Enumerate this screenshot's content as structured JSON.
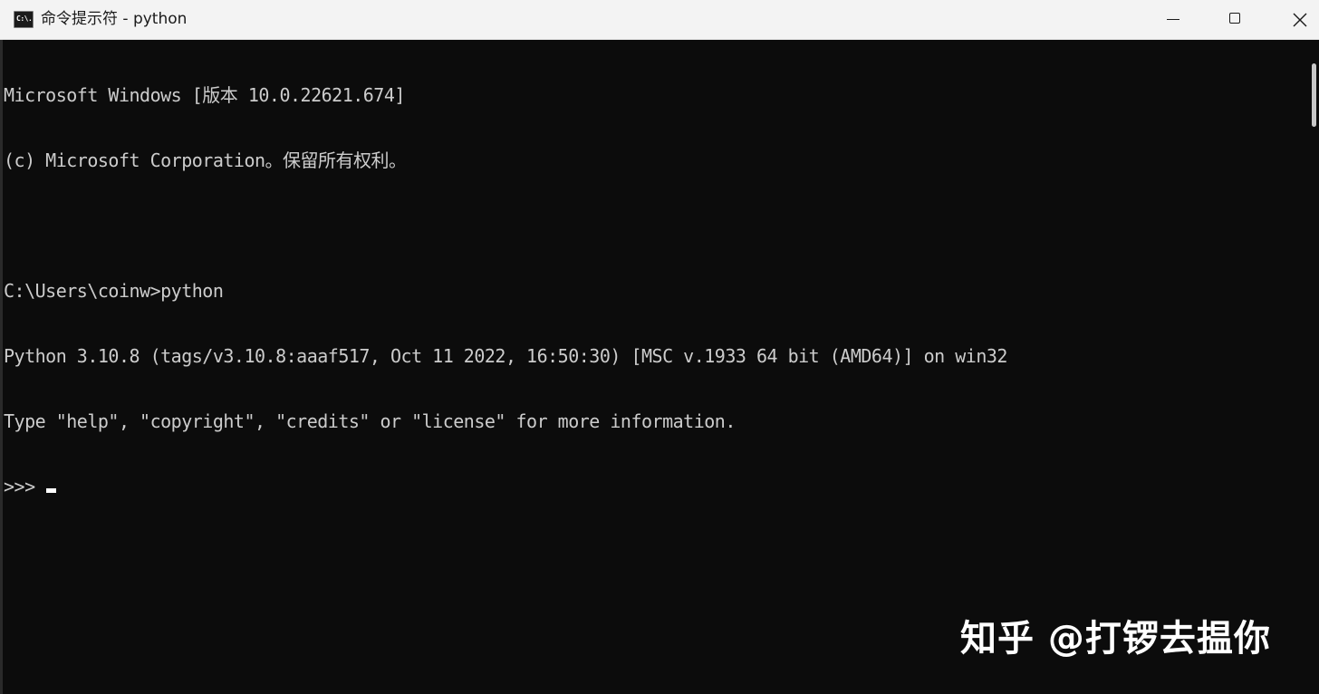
{
  "window": {
    "icon": "cmd-icon",
    "icon_glyph": "C:\\.",
    "title": "命令提示符 - python",
    "controls": {
      "minimize": "minimize-icon",
      "maximize": "maximize-icon",
      "close": "close-icon"
    }
  },
  "console": {
    "lines": [
      "Microsoft Windows [版本 10.0.22621.674]",
      "(c) Microsoft Corporation。保留所有权利。",
      "",
      "C:\\Users\\coinw>python",
      "Python 3.10.8 (tags/v3.10.8:aaaf517, Oct 11 2022, 16:50:30) [MSC v.1933 64 bit (AMD64)] on win32",
      "Type \"help\", \"copyright\", \"credits\" or \"license\" for more information."
    ],
    "prompt": ">>>"
  },
  "watermark": "知乎 @打锣去揾你",
  "colors": {
    "console_bg": "#0c0c0c",
    "console_text": "#cccccc",
    "titlebar_bg": "#f3f3f3"
  }
}
